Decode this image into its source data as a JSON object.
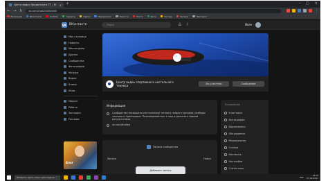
{
  "browser": {
    "tab_title": "Центр видео Эрудитского ТТ – М",
    "new_tab_glyph": "+",
    "window_controls": [
      "–",
      "□",
      "✕"
    ],
    "url": "vk.com/club200000000",
    "bookmarks": [
      {
        "label": "Входящие",
        "color": "#d93025"
      },
      {
        "label": "ВКонтакте",
        "color": "#4a76a8"
      },
      {
        "label": "YouTube",
        "color": "#ff0000"
      },
      {
        "label": "Сервисы",
        "color": "#34a853"
      },
      {
        "label": "Карты",
        "color": "#fbbc04"
      },
      {
        "label": "Переводчик",
        "color": "#4285f4"
      },
      {
        "label": "Новости",
        "color": "#9aa0a6"
      },
      {
        "label": "Почта",
        "color": "#d93025"
      },
      {
        "label": "Диск",
        "color": "#0f9d58"
      },
      {
        "label": "Погода",
        "color": "#f4b400"
      },
      {
        "label": "Музыка",
        "color": "#db4437"
      },
      {
        "label": "Закладки",
        "color": "#9aa0a6"
      }
    ],
    "extensions": [
      "#e8453c",
      "#f5b400",
      "#4a76a8",
      "#9aa0a6",
      "#e8453c"
    ]
  },
  "vk": {
    "logo": "VK",
    "brand": "ВКонтакте",
    "search_placeholder": "Поиск",
    "user_name": "Иван"
  },
  "menu": {
    "items": [
      "Моя страница",
      "Новости",
      "Мессенджер",
      "Друзья",
      "Сообщества",
      "Фотографии",
      "Музыка",
      "Видео",
      "Клипы",
      "Игры"
    ],
    "secondary": [
      "Маркет",
      "Работа",
      "Закладки",
      "Реклама"
    ],
    "footer": "Блог"
  },
  "group": {
    "title": "Центр видео спортивного настольного тенниса",
    "member_label": "Вы участник",
    "message_label": "Сообщение"
  },
  "info": {
    "heading": "Информация",
    "description": "Сообщество посвящено настольному теннису: видео турниров, разборы техники и тренировки. Присоединяйтесь к нам и делитесь своими результатами.",
    "website": "vk.com/ttvideo"
  },
  "post": {
    "title": "Записи сообщества",
    "left_label": "Записи",
    "right_label": "Поиск",
    "button_label": "Добавить запись"
  },
  "right_menu": {
    "heading": "Управление",
    "items": [
      "Участники",
      "Фотографии",
      "Видеозаписи",
      "Обсуждения",
      "Мероприятия",
      "Ссылки",
      "Контакты",
      "Настройки",
      "Статистика"
    ]
  },
  "taskbar": {
    "search_placeholder": "Введите здесь текст для поиска",
    "apps": [
      "#f5b400",
      "#3478d4",
      "#e8453c",
      "#34a853",
      "#8e44ad",
      "#2d7dd2"
    ],
    "time": "14:25",
    "date": "07.03.2021",
    "lang": "РУС"
  }
}
